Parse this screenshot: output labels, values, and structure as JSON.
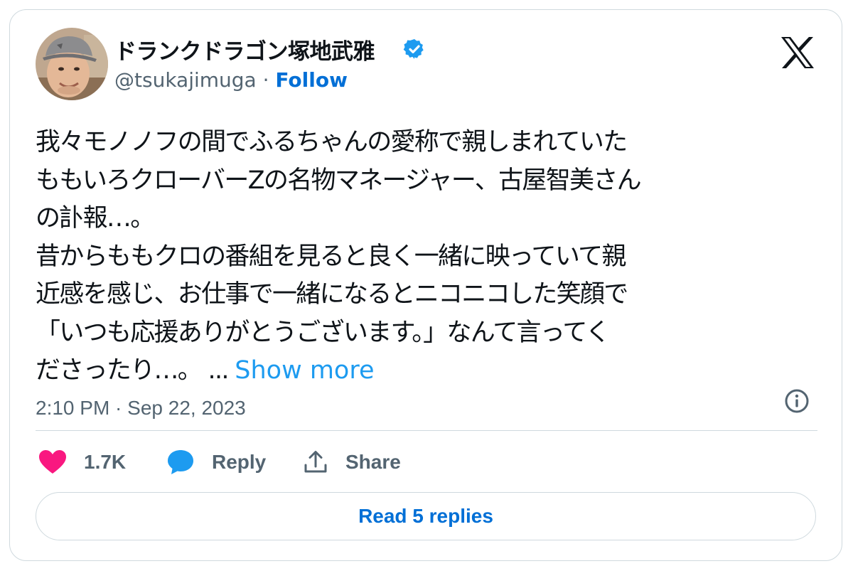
{
  "author": {
    "name": "ドランクドラゴン塚地武雅",
    "handle": "@tsukajimuga",
    "separator": " · ",
    "follow_label": "Follow",
    "verified": true,
    "avatar_icon": "user-avatar-photo"
  },
  "platform_icon": "x-logo-icon",
  "tweet": {
    "lines": [
      "我々モノノフの間でふるちゃんの愛称で親しまれていた",
      "ももいろクローバーZの名物マネージャー、古屋智美さん",
      "の訃報…。",
      "昔からももクロの番組を見ると良く一緒に映っていて親",
      "近感を感じ、お仕事で一緒になるとニコニコした笑顔で",
      "「いつも応援ありがとうございます。」なんて言ってく",
      "ださったり…。"
    ],
    "ellipsis": "...",
    "show_more_label": "Show more"
  },
  "timestamp": "2:10 PM · Sep 22, 2023",
  "actions": {
    "like_count": "1.7K",
    "reply_label": "Reply",
    "share_label": "Share"
  },
  "read_replies_label": "Read 5 replies",
  "colors": {
    "accent_blue": "#1d9bf0",
    "link_blue": "#006fd6",
    "like_pink": "#f91880",
    "text_primary": "#0f1419",
    "text_secondary": "#536471",
    "border": "#cfd9de"
  }
}
